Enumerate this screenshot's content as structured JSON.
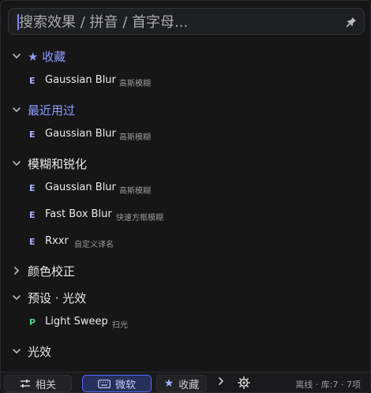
{
  "search": {
    "placeholder": "搜索效果 / 拼音 / 首字母...",
    "pin_icon": "pin-icon"
  },
  "groups": [
    {
      "label": "★ 收藏",
      "expanded": true,
      "accent": true
    },
    {
      "label": "最近用过",
      "expanded": true,
      "accent": true
    },
    {
      "label": "模糊和锐化",
      "expanded": true,
      "accent": false
    },
    {
      "label": "颜色校正",
      "expanded": false,
      "accent": false
    },
    {
      "label": "预设 · 光效",
      "expanded": true,
      "accent": false
    },
    {
      "label": "光效",
      "expanded": true,
      "accent": false
    }
  ],
  "items": {
    "fav": [
      {
        "badge": "E",
        "name": "Gaussian Blur",
        "alias": "高斯模糊"
      }
    ],
    "recent": [
      {
        "badge": "E",
        "name": "Gaussian Blur",
        "alias": "高斯模糊"
      }
    ],
    "blur": [
      {
        "badge": "E",
        "name": "Gaussian Blur",
        "alias": "高斯模糊"
      },
      {
        "badge": "E",
        "name": "Fast Box Blur",
        "alias": "快速方框模糊"
      },
      {
        "badge": "E",
        "name": "Rxxr",
        "alias": "自定义译名"
      }
    ],
    "preset": [
      {
        "badge": "P",
        "name": "Light Sweep",
        "alias": "扫光"
      }
    ]
  },
  "footer": {
    "related_label": "相关",
    "ime_label": "微软",
    "fav_label": "收藏",
    "status": "离线 · 库:7 · 7项"
  },
  "colors": {
    "accent": "#8f9cff",
    "badge_effect": "#a9b1ff",
    "badge_preset": "#48d48a",
    "active_border": "#5668ff"
  }
}
